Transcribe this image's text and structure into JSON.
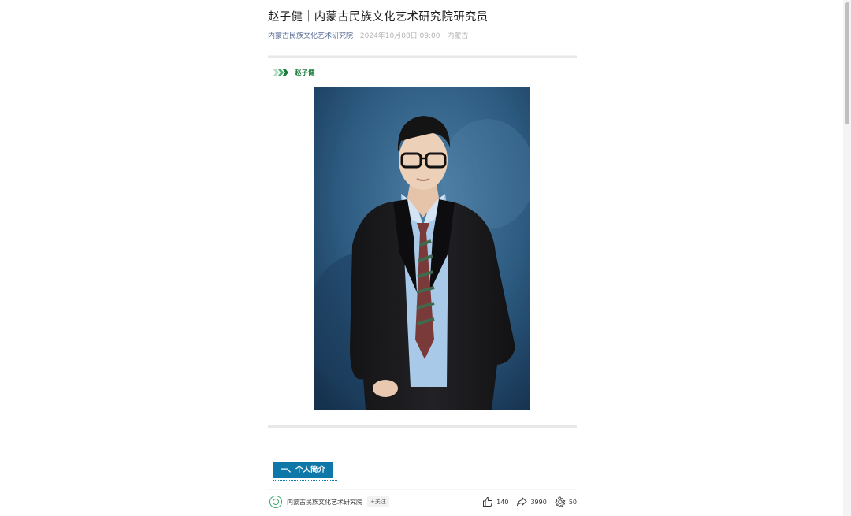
{
  "article": {
    "title": "赵子健｜内蒙古民族文化艺术研究院研究员",
    "author": "内蒙古民族文化艺术研究院",
    "date": "2024年10月08日 09:00",
    "location": "内蒙古"
  },
  "person": {
    "name": "赵子健"
  },
  "section": {
    "heading": "一、个人简介"
  },
  "footer": {
    "account_name": "内蒙古民族文化艺术研究院",
    "follow_label": "+关注",
    "likes": "140",
    "shares": "3990",
    "recommends": "50"
  },
  "icons": {
    "chevron": "triple-chevron-icon",
    "like": "thumbs-up-icon",
    "share": "share-arrow-icon",
    "recommend": "gear-flower-icon",
    "avatar": "account-logo-icon"
  },
  "colors": {
    "accent_green": "#1a7a3a",
    "section_blue": "#0e78a8",
    "author_link": "#576b95"
  }
}
